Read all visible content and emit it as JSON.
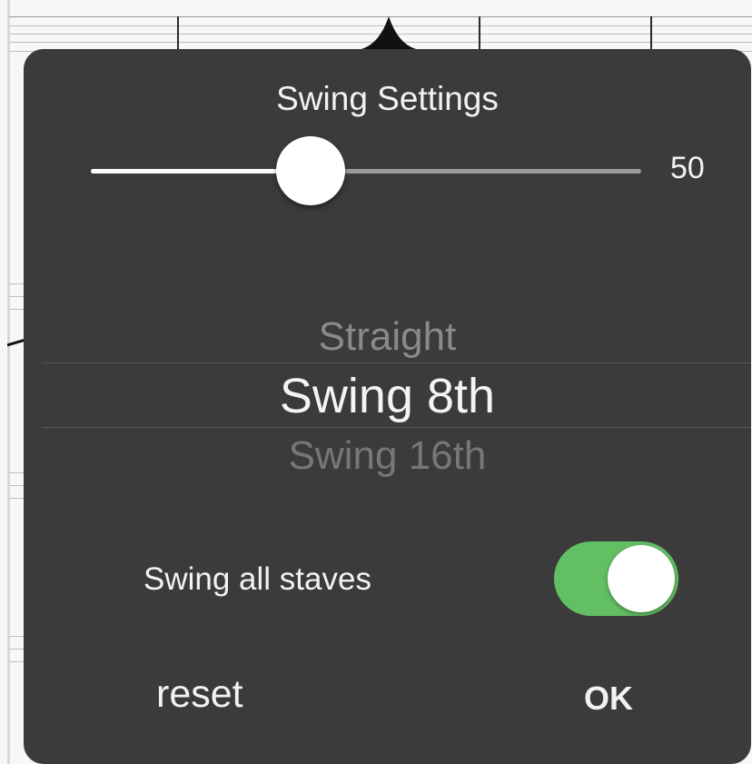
{
  "dialog": {
    "title": "Swing Settings"
  },
  "slider": {
    "value": 50,
    "value_label": "50",
    "min": 0,
    "max": 100,
    "fill_fraction": 0.4
  },
  "picker": {
    "items": [
      "Straight",
      "Swing 8th",
      "Swing 16th"
    ],
    "selected_index": 1
  },
  "toggle": {
    "label": "Swing all staves",
    "on": true,
    "on_color": "#62bf64"
  },
  "buttons": {
    "reset_label": "reset",
    "ok_label": "OK"
  },
  "colors": {
    "popover_bg": "#3b3b3b",
    "text": "#f2f2f2"
  }
}
